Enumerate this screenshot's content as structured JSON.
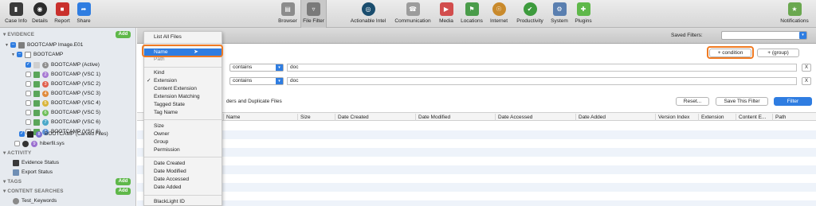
{
  "toolbar": {
    "left": [
      {
        "label": "Case Info",
        "icon": "case-info-icon"
      },
      {
        "label": "Details",
        "icon": "details-icon"
      },
      {
        "label": "Report",
        "icon": "report-icon"
      },
      {
        "label": "Share",
        "icon": "share-icon"
      }
    ],
    "views": [
      {
        "label": "Browser",
        "icon": "browser-icon"
      },
      {
        "label": "File Filter",
        "icon": "file-filter-icon"
      }
    ],
    "categories": [
      {
        "label": "Actionable Intel",
        "icon": "actionable-intel-icon"
      },
      {
        "label": "Communication",
        "icon": "communication-icon"
      },
      {
        "label": "Media",
        "icon": "media-icon"
      },
      {
        "label": "Locations",
        "icon": "locations-icon"
      },
      {
        "label": "Internet",
        "icon": "internet-icon"
      },
      {
        "label": "Productivity",
        "icon": "productivity-icon"
      },
      {
        "label": "System",
        "icon": "system-icon"
      },
      {
        "label": "Plugins",
        "icon": "plugins-icon"
      }
    ],
    "notifications": "Notifications"
  },
  "sidebar": {
    "evidence_title": "EVIDENCE",
    "add_label": "Add",
    "image_label": "BOOTCAMP Image.E01",
    "bootcamp_label": "BOOTCAMP",
    "volumes": [
      {
        "num": "1",
        "label": "BOOTCAMP (Active)",
        "checked": true
      },
      {
        "num": "2",
        "label": "BOOTCAMP (VSC 1)",
        "checked": false
      },
      {
        "num": "3",
        "label": "BOOTCAMP (VSC 2)",
        "checked": false
      },
      {
        "num": "4",
        "label": "BOOTCAMP (VSC 3)",
        "checked": false
      },
      {
        "num": "5",
        "label": "BOOTCAMP (VSC 4)",
        "checked": false
      },
      {
        "num": "6",
        "label": "BOOTCAMP (VSC 5)",
        "checked": false
      },
      {
        "num": "7",
        "label": "BOOTCAMP (VSC 6)",
        "checked": false
      }
    ],
    "carved_num": "8",
    "carved_label": "BOOTCAMP (Carved Files)",
    "hiberfil_num": "9",
    "hiberfil_label": "hiberfil.sys",
    "activity_title": "ACTIVITY",
    "evidence_status": "Evidence Status",
    "export_status": "Export Status",
    "tags_title": "TAGS",
    "content_searches_title": "CONTENT SEARCHES",
    "test_keywords": "Test_Keywords"
  },
  "main": {
    "saved_filters_label": "Saved Filters:",
    "add_condition": "+ condition",
    "add_group": "+ (group)",
    "conditions": [
      {
        "operator": "contains",
        "value": "doc",
        "remove": "X"
      },
      {
        "operator": "contains",
        "value": "doc",
        "remove": "X"
      }
    ],
    "option_text": "ders and Duplicate Files",
    "reset": "Reset...",
    "save_filter": "Save This Filter",
    "filter": "Filter",
    "columns": [
      "Name",
      "Size",
      "Date Created",
      "Date Modified",
      "Date Accessed",
      "Date Added",
      "Version Index",
      "Extension",
      "Content E...",
      "Path"
    ]
  },
  "menu": {
    "items": [
      {
        "label": "List All Files"
      },
      {
        "label": "Name",
        "selected": true
      },
      {
        "label": "Path"
      },
      {
        "label": "Kind"
      },
      {
        "label": "Extension",
        "checked": true
      },
      {
        "label": "Content Extension"
      },
      {
        "label": "Extension Matching"
      },
      {
        "label": "Tagged State"
      },
      {
        "label": "Tag Name"
      },
      {
        "label": "Size"
      },
      {
        "label": "Owner"
      },
      {
        "label": "Group"
      },
      {
        "label": "Permission"
      },
      {
        "label": "Date Created"
      },
      {
        "label": "Date Modified"
      },
      {
        "label": "Date Accessed"
      },
      {
        "label": "Date Added"
      },
      {
        "label": "BlackLight ID"
      }
    ]
  },
  "colors": {
    "accent": "#2f7de1",
    "highlight": "#f07a22",
    "add_green": "#5fb84a",
    "sidebar_bg": "#e6eaef"
  }
}
